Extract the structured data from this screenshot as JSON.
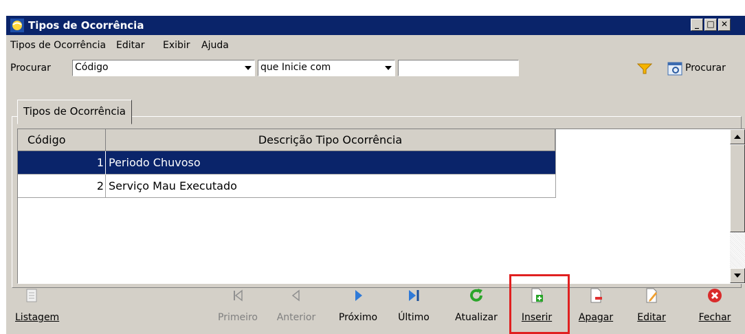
{
  "window": {
    "title": "Tipos de Ocorrência",
    "controls": [
      "minimize",
      "maximize",
      "close"
    ]
  },
  "menu": [
    {
      "label": "Tipos de Ocorrência"
    },
    {
      "label": "Editar"
    },
    {
      "label": "Exibir"
    },
    {
      "label": "Ajuda"
    }
  ],
  "search": {
    "label": "Procurar",
    "field_value": "Código",
    "condition_value": "que Inicie com",
    "text_value": "",
    "button_label": "Procurar"
  },
  "tab": {
    "label": "Tipos de Ocorrência"
  },
  "table": {
    "columns": [
      "Código",
      "Descrição Tipo Ocorrência"
    ],
    "rows": [
      {
        "codigo": "1",
        "descricao": "Periodo Chuvoso",
        "selected": true
      },
      {
        "codigo": "2",
        "descricao": "Serviço Mau Executado",
        "selected": false
      }
    ]
  },
  "toolbar": {
    "listagem": "Listagem",
    "primeiro": "Primeiro",
    "anterior": "Anterior",
    "proximo": "Próximo",
    "ultimo": "Último",
    "atualizar": "Atualizar",
    "inserir": "Inserir",
    "apagar": "Apagar",
    "editar": "Editar",
    "fechar": "Fechar"
  },
  "colors": {
    "titlebar": "#0a246a",
    "selection": "#0a246a",
    "highlight_box": "#e02020"
  }
}
